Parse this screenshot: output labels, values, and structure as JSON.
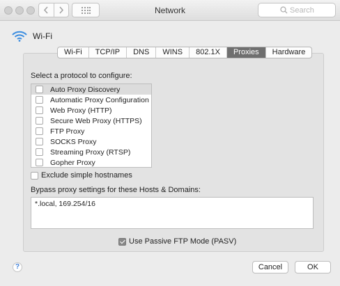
{
  "window": {
    "title": "Network"
  },
  "toolbar": {
    "search_placeholder": "Search"
  },
  "header": {
    "title": "Wi-Fi"
  },
  "tabs": [
    {
      "label": "Wi-Fi",
      "active": false
    },
    {
      "label": "TCP/IP",
      "active": false
    },
    {
      "label": "DNS",
      "active": false
    },
    {
      "label": "WINS",
      "active": false
    },
    {
      "label": "802.1X",
      "active": false
    },
    {
      "label": "Proxies",
      "active": true
    },
    {
      "label": "Hardware",
      "active": false
    }
  ],
  "proxies": {
    "select_label": "Select a protocol to configure:",
    "protocols": [
      {
        "label": "Auto Proxy Discovery",
        "checked": false,
        "selected": true
      },
      {
        "label": "Automatic Proxy Configuration",
        "checked": false,
        "selected": false
      },
      {
        "label": "Web Proxy (HTTP)",
        "checked": false,
        "selected": false
      },
      {
        "label": "Secure Web Proxy (HTTPS)",
        "checked": false,
        "selected": false
      },
      {
        "label": "FTP Proxy",
        "checked": false,
        "selected": false
      },
      {
        "label": "SOCKS Proxy",
        "checked": false,
        "selected": false
      },
      {
        "label": "Streaming Proxy (RTSP)",
        "checked": false,
        "selected": false
      },
      {
        "label": "Gopher Proxy",
        "checked": false,
        "selected": false
      }
    ],
    "exclude_label": "Exclude simple hostnames",
    "exclude_checked": false,
    "bypass_label": "Bypass proxy settings for these Hosts & Domains:",
    "bypass_value": "*.local, 169.254/16",
    "pasv_label": "Use Passive FTP Mode (PASV)",
    "pasv_checked": true
  },
  "footer": {
    "help_label": "?",
    "cancel_label": "Cancel",
    "ok_label": "OK"
  },
  "colors": {
    "wifi_icon": "#3b8de0",
    "active_tab": "#6f6f6f"
  }
}
